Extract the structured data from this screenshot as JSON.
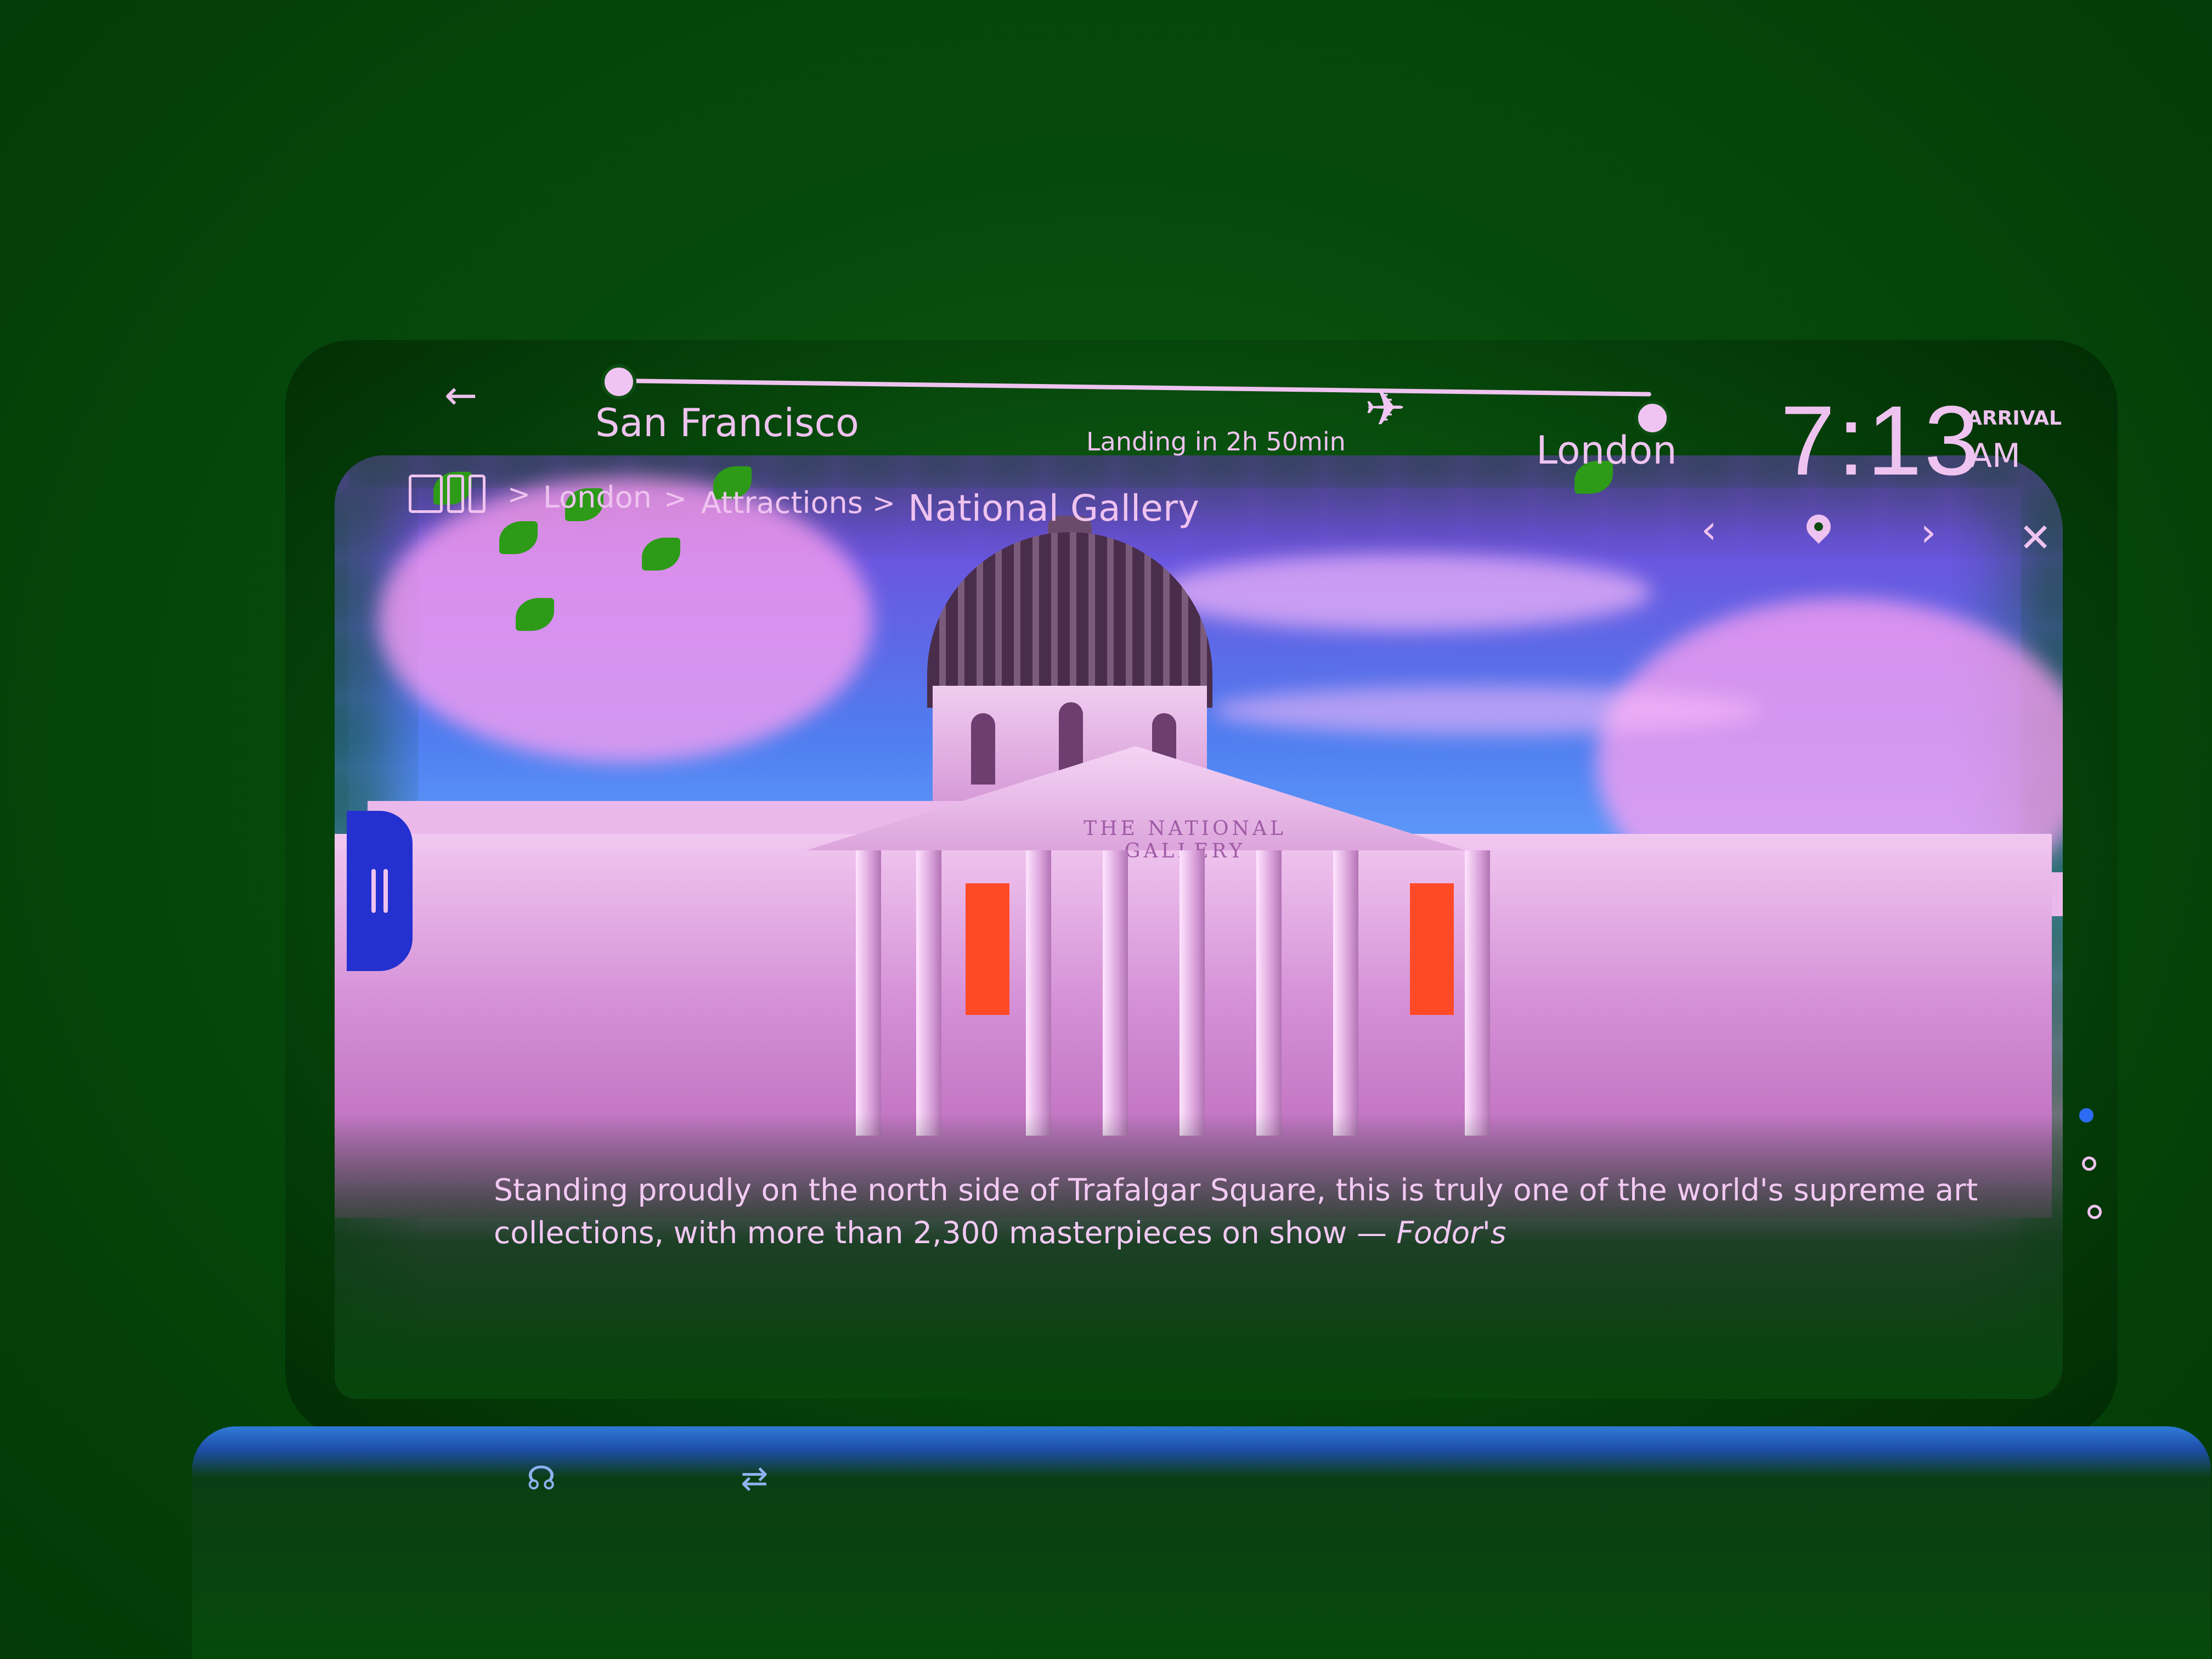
{
  "flight": {
    "origin": "San Francisco",
    "destination": "London",
    "status": "Landing in 2h 50min",
    "arrival_time": "7:13",
    "arrival_label": "ARRIVAL",
    "arrival_ampm": "AM"
  },
  "breadcrumb": {
    "items": [
      "London",
      "Attractions",
      "National Gallery"
    ],
    "separator": ">"
  },
  "pediment_inscription": "THE NATIONAL GALLERY",
  "caption": {
    "text": "Standing proudly on the north side of Trafalgar Square, this is truly one of the world's supreme art collections, with more than 2,300 masterpieces on show —",
    "source": "Fodor's"
  },
  "icons": {
    "back": "back-arrow-icon",
    "plane": "plane-icon",
    "grid": "grid-icon",
    "prev": "chevron-left-icon",
    "location": "location-pin-icon",
    "next": "chevron-right-icon",
    "close": "close-icon",
    "pause": "pause-icon",
    "headphone": "headphone-icon",
    "usb": "usb-icon"
  },
  "carousel": {
    "total_pages": 3,
    "active_page": 1
  },
  "colors": {
    "ui_text": "#efc3f0",
    "pause_button": "#2430cf",
    "active_dot": "#2c6cf5",
    "banner": "#ff4a28"
  }
}
